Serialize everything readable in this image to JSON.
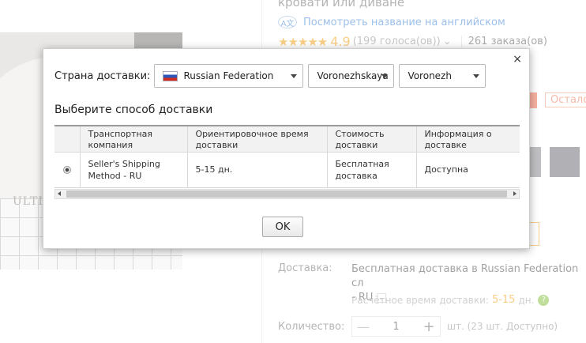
{
  "background": {
    "ulti_text": "ULTI",
    "product_title_tail": "кровати или диване",
    "translate_icon": "A文",
    "translate_link": "Посмотреть название на английском",
    "stars": "★★★★★",
    "rating": "4.9",
    "votes": "(199 голоса(ов))",
    "votes_chevron": "⌄",
    "orders": "261 заказа(ов)",
    "remaining_badge": "Остало",
    "shipping_label": "Доставка:",
    "shipping_value_line1": "Бесплатная доставка в Russian Federation сл",
    "shipping_value_line2": "- RU",
    "shipping_dropdown_icon": "⌄",
    "eta_label": "Расчётное время доставки:",
    "eta_days": "5-15",
    "eta_unit": "дн.",
    "help_icon": "?",
    "quantity_label": "Количество:",
    "qty_minus": "—",
    "quantity_value": "1",
    "qty_plus": "+",
    "stock_text": "шт. (23 шт. Доступно)"
  },
  "dialog": {
    "close_glyph": "×",
    "country_label": "Страна доставки:",
    "country_value": "Russian Federation",
    "region_value": "Voronezhskaya",
    "city_value": "Voronezh",
    "method_title": "Выберите способ доставки",
    "table": {
      "headers": [
        "Транспортная компания",
        "Ориентировочное время доставки",
        "Стоимость доставки",
        "Информация о доставке"
      ],
      "rows": [
        [
          "Seller's Shipping Method - RU",
          "5-15 дн.",
          "Бесплатная доставка",
          "Доступна"
        ]
      ]
    },
    "ok_label": "OK"
  },
  "colors": {
    "accent_orange": "#f5a623",
    "link_blue": "#4a8ad9",
    "help_green": "#8bc34a"
  }
}
